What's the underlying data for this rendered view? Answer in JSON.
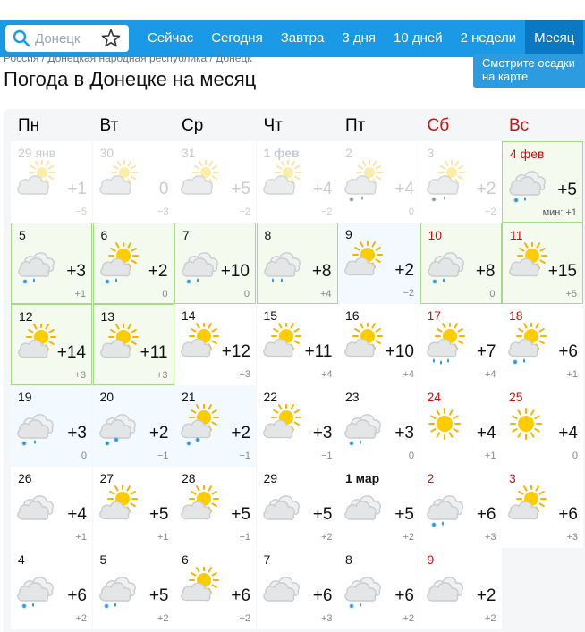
{
  "header": {
    "search_placeholder": "Донецк",
    "nav": [
      "Сейчас",
      "Сегодня",
      "Завтра",
      "3 дня",
      "10 дней",
      "2 недели",
      "Месяц"
    ],
    "active_tab": 6
  },
  "breadcrumb": "Россия / Донецкая народная республика / Донецк",
  "page_title": "Погода в Донецке на месяц",
  "map_button": [
    "Смотрите осадки",
    "на карте"
  ],
  "weekdays": [
    "Пн",
    "Вт",
    "Ср",
    "Чт",
    "Пт",
    "Сб",
    "Вс"
  ],
  "colors": {
    "brand": "#1a9ae6",
    "active_tab": "#0b78c4",
    "weekend": "#cc1111",
    "past_text": "#c8ccd0"
  },
  "days": [
    {
      "date": "29 янв",
      "day": "+1",
      "night": "−5",
      "icon": "cloudy-sun",
      "state": "past"
    },
    {
      "date": "30",
      "day": "0",
      "night": "−3",
      "icon": "cloudy-sun",
      "state": "past"
    },
    {
      "date": "31",
      "day": "+5",
      "night": "−2",
      "icon": "cloudy-sun",
      "state": "past"
    },
    {
      "date": "1 фев",
      "day": "+4",
      "night": "−2",
      "icon": "cloudy-sun",
      "state": "past",
      "bold": true
    },
    {
      "date": "2",
      "day": "+4",
      "night": "0",
      "icon": "cloudy-sun-rain-snow",
      "state": "past"
    },
    {
      "date": "3",
      "day": "+2",
      "night": "−2",
      "icon": "cloudy-sun-rain-snow",
      "state": "past"
    },
    {
      "date": "4 фев",
      "day": "+5",
      "night": "мин: +1",
      "icon": "cloudy-snow-rain",
      "state": "green",
      "min": true
    },
    {
      "date": "5",
      "day": "+3",
      "night": "+1",
      "icon": "cloudy-snow-rain",
      "state": "green"
    },
    {
      "date": "6",
      "day": "+2",
      "night": "0",
      "icon": "sun-cloud-snow-rain",
      "state": "green"
    },
    {
      "date": "7",
      "day": "+10",
      "night": "0",
      "icon": "cloudy-snow-rain",
      "state": "green"
    },
    {
      "date": "8",
      "day": "+8",
      "night": "+4",
      "icon": "cloudy-rain",
      "state": "green"
    },
    {
      "date": "9",
      "day": "+2",
      "night": "−2",
      "icon": "sun-cloud",
      "state": "blue"
    },
    {
      "date": "10",
      "day": "+8",
      "night": "0",
      "icon": "cloudy-snow-rain",
      "state": "green"
    },
    {
      "date": "11",
      "day": "+15",
      "night": "+5",
      "icon": "sun-cloud",
      "state": "green"
    },
    {
      "date": "12",
      "day": "+14",
      "night": "+3",
      "icon": "sun-cloud",
      "state": "green"
    },
    {
      "date": "13",
      "day": "+11",
      "night": "+3",
      "icon": "sun-cloud",
      "state": "green"
    },
    {
      "date": "14",
      "day": "+12",
      "night": "+3",
      "icon": "sun-cloud",
      "state": "plain"
    },
    {
      "date": "15",
      "day": "+11",
      "night": "+4",
      "icon": "sun-cloud",
      "state": "plain"
    },
    {
      "date": "16",
      "day": "+10",
      "night": "+4",
      "icon": "sun-cloud",
      "state": "plain"
    },
    {
      "date": "17",
      "day": "+7",
      "night": "+4",
      "icon": "sun-cloud-rain",
      "state": "plain"
    },
    {
      "date": "18",
      "day": "+6",
      "night": "+1",
      "icon": "sun-cloud-snow-rain",
      "state": "plain"
    },
    {
      "date": "19",
      "day": "+3",
      "night": "0",
      "icon": "cloudy-rain-snow",
      "state": "blue"
    },
    {
      "date": "20",
      "day": "+2",
      "night": "−1",
      "icon": "cloudy-snow",
      "state": "blue"
    },
    {
      "date": "21",
      "day": "+2",
      "night": "−1",
      "icon": "sun-cloud-snow",
      "state": "blue"
    },
    {
      "date": "22",
      "day": "+3",
      "night": "−1",
      "icon": "sun-cloud",
      "state": "plain"
    },
    {
      "date": "23",
      "day": "+3",
      "night": "0",
      "icon": "cloudy-snow-rain",
      "state": "plain"
    },
    {
      "date": "24",
      "day": "+4",
      "night": "+1",
      "icon": "sun",
      "state": "plain"
    },
    {
      "date": "25",
      "day": "+4",
      "night": "0",
      "icon": "sun",
      "state": "plain"
    },
    {
      "date": "26",
      "day": "+4",
      "night": "+1",
      "icon": "cloudy",
      "state": "plain"
    },
    {
      "date": "27",
      "day": "+5",
      "night": "+1",
      "icon": "sun-cloud",
      "state": "plain"
    },
    {
      "date": "28",
      "day": "+5",
      "night": "+1",
      "icon": "sun-cloud",
      "state": "plain"
    },
    {
      "date": "29",
      "day": "+5",
      "night": "+2",
      "icon": "cloudy",
      "state": "plain"
    },
    {
      "date": "1 мар",
      "day": "+5",
      "night": "+2",
      "icon": "cloudy",
      "state": "plain",
      "bold": true
    },
    {
      "date": "2",
      "day": "+6",
      "night": "+3",
      "icon": "cloudy-snow-rain",
      "state": "plain"
    },
    {
      "date": "3",
      "day": "+6",
      "night": "+3",
      "icon": "sun-cloud",
      "state": "plain"
    },
    {
      "date": "4",
      "day": "+6",
      "night": "+2",
      "icon": "cloudy-snow-rain",
      "state": "plain"
    },
    {
      "date": "5",
      "day": "+5",
      "night": "+2",
      "icon": "cloudy-snow-rain",
      "state": "plain"
    },
    {
      "date": "6",
      "day": "+6",
      "night": "+2",
      "icon": "sun-cloud",
      "state": "plain"
    },
    {
      "date": "7",
      "day": "+6",
      "night": "+3",
      "icon": "cloudy",
      "state": "plain"
    },
    {
      "date": "8",
      "day": "+6",
      "night": "+2",
      "icon": "cloudy-snow-rain",
      "state": "plain"
    },
    {
      "date": "9",
      "day": "+2",
      "night": "+2",
      "icon": "cloudy",
      "state": "plain"
    }
  ]
}
